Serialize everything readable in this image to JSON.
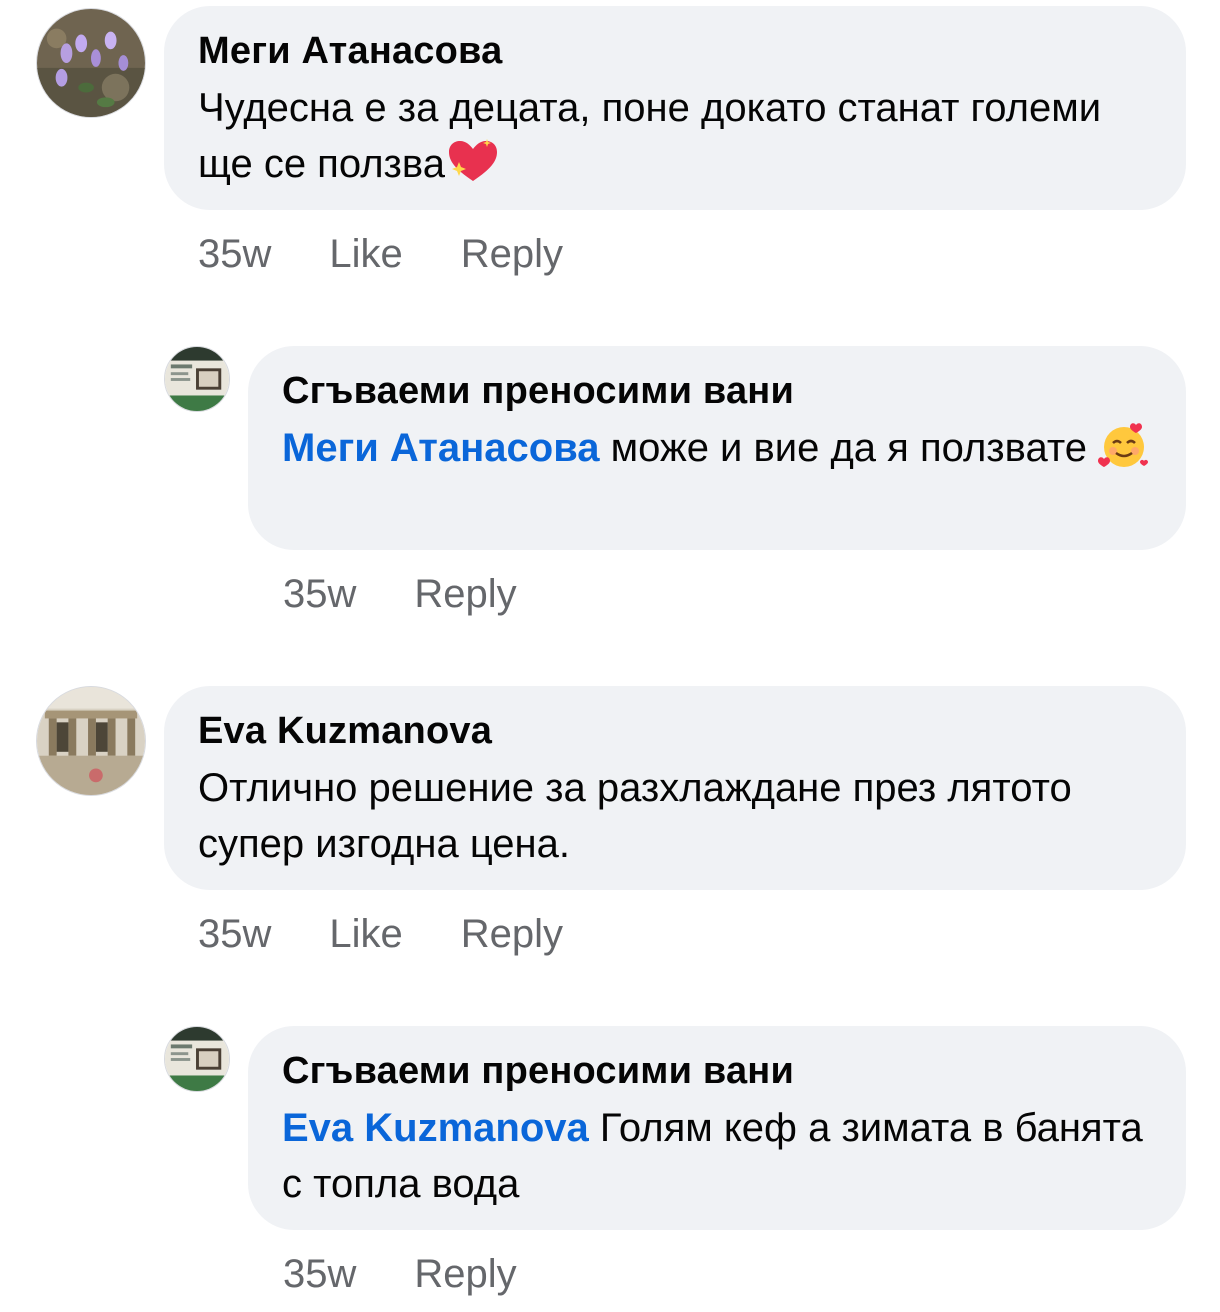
{
  "comments": [
    {
      "author": "Меги Атанасова",
      "text": "Чудесна е за децата, поне докато станат големи ще се ползва",
      "emoji": "sparkling-heart-icon",
      "time": "35w",
      "like_label": "Like",
      "reply_label": "Reply"
    },
    {
      "author": "Сгъваеми преносими вани",
      "mention": "Меги Атанасова",
      "text": " може и вие да я ползвате ",
      "emoji": "smiling-face-with-hearts-icon",
      "time": "35w",
      "reply_label": "Reply"
    },
    {
      "author": "Eva Kuzmanova",
      "text": "Отлично решение за разхлаждане през лятото супер изгодна цена.",
      "time": "35w",
      "like_label": "Like",
      "reply_label": "Reply"
    },
    {
      "author": "Сгъваеми преносими вани",
      "mention": "Eva Kuzmanova",
      "text": " Голям кеф а зимата в банята с топла вода",
      "time": "35w",
      "reply_label": "Reply"
    }
  ],
  "colors": {
    "bubble": "#f0f2f5",
    "mention": "#0a66d9",
    "meta": "#65676b"
  }
}
